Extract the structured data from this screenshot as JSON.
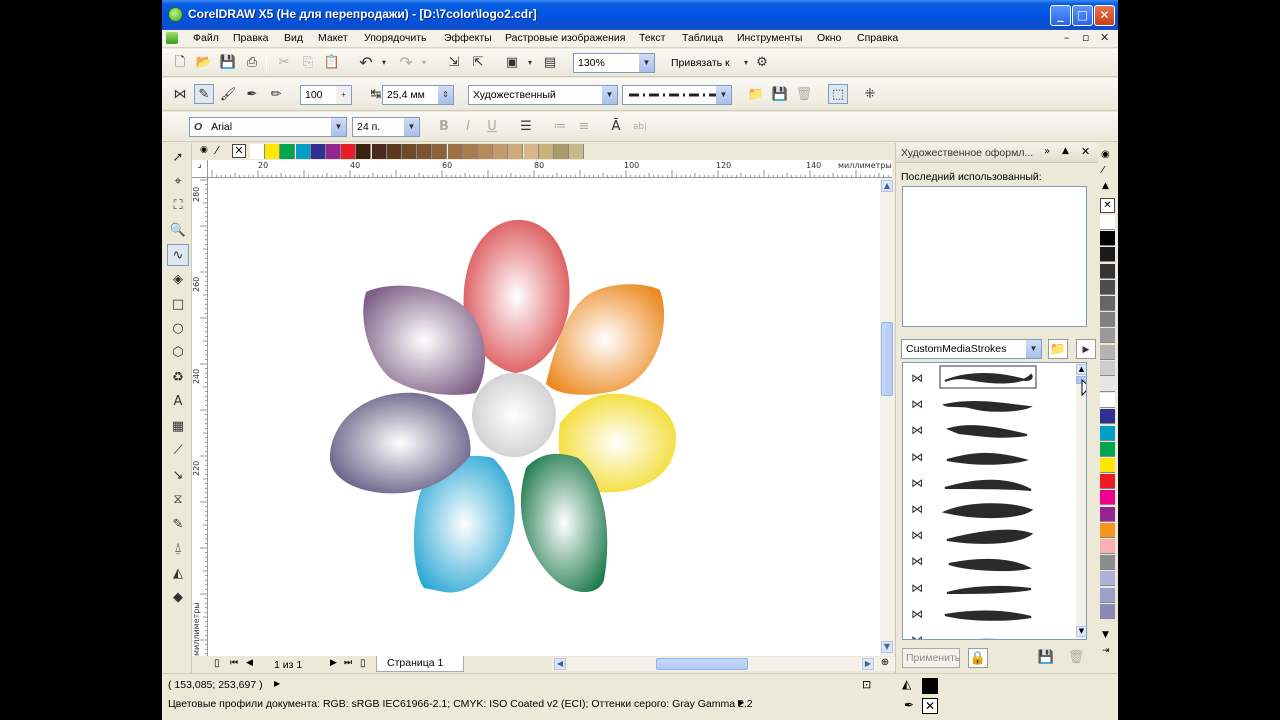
{
  "window": {
    "title": "CorelDRAW X5 (Не для перепродажи) - [D:\\7color\\logo2.cdr]"
  },
  "menu": [
    "Файл",
    "Правка",
    "Вид",
    "Макет",
    "Упорядочить",
    "Эффекты",
    "Растровые изображения",
    "Текст",
    "Таблица",
    "Инструменты",
    "Окно",
    "Справка"
  ],
  "standard_toolbar": {
    "zoom": "130%",
    "snap_label": "Привязать к"
  },
  "property_bar": {
    "smoothing": "100",
    "width": "25,4 мм",
    "mode": "Художественный"
  },
  "text_bar": {
    "font": "Arial",
    "size": "24 п."
  },
  "ruler": {
    "h_labels": [
      "20",
      "40",
      "60",
      "80",
      "100",
      "120",
      "140"
    ],
    "units": "миллиметры",
    "v_labels": [
      "280",
      "260",
      "240",
      "220"
    ],
    "v_units": "миллиметры"
  },
  "page_nav": {
    "counter": "1 из 1",
    "tab": "Страница 1"
  },
  "docker": {
    "title": "Художественное оформл...",
    "recent_label": "Последний использованный:",
    "category": "CustomMediaStrokes",
    "apply_label": "Применить"
  },
  "status": {
    "coords": "( 153,085; 253,697 )",
    "color_profiles": "Цветовые профили документа: RGB: sRGB IEC61966-2.1; CMYK: ISO Coated v2 (ECI); Оттенки серого: Gray Gamma 2.2"
  },
  "colors": {
    "top_palette": [
      "#ffffff",
      "#ffe800",
      "#00a64f",
      "#00a0c6",
      "#2e3191",
      "#93278f",
      "#ec1c24",
      "#3b2314",
      "#4a2a18",
      "#5c3a22",
      "#6e4a2a",
      "#7d5532",
      "#8c6239",
      "#9c7245",
      "#a97c50",
      "#b58a5c",
      "#c39a6b",
      "#cfa97a",
      "#d6b88c",
      "#c8b27a",
      "#a89a6a",
      "#c9b98a"
    ],
    "right_palette": [
      "#ffffff",
      "#000000",
      "#1a1a1a",
      "#333333",
      "#4d4d4d",
      "#666666",
      "#808080",
      "#999999",
      "#b3b3b3",
      "#cccccc",
      "#e6e6e6",
      "#ffffff",
      "#2e3191",
      "#00a0c6",
      "#00a64f",
      "#ffe800",
      "#ec1c24",
      "#ec008c",
      "#93278f",
      "#f7941d",
      "#f9b0b0",
      "#8c8c8c",
      "#b0b0d8",
      "#9e9ec8",
      "#8a8ab8"
    ]
  }
}
